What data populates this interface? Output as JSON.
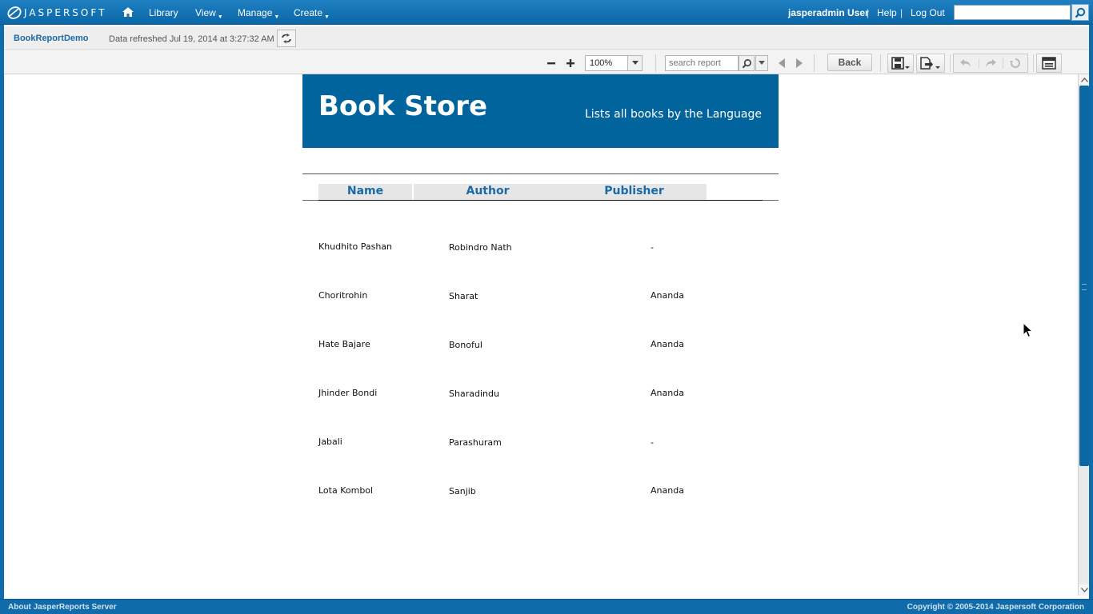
{
  "topbar": {
    "logo_text": "JASPERSOFT",
    "nav": {
      "library": "Library",
      "view": "View",
      "manage": "Manage",
      "create": "Create"
    },
    "user": "jasperadmin User",
    "help": "Help",
    "logout": "Log Out",
    "separator": "|",
    "search_value": ""
  },
  "titlebar": {
    "report_name": "BookReportDemo",
    "refresh_text": "Data refreshed Jul 19, 2014 at 3:27:32 AM"
  },
  "toolbar": {
    "zoom": "100%",
    "search_placeholder": "search report",
    "back_label": "Back"
  },
  "report": {
    "title": "Book Store",
    "subtitle": "Lists all books by the Language",
    "columns": {
      "name": "Name",
      "author": "Author",
      "publisher": "Publisher"
    },
    "rows": [
      {
        "name": "Khudhito Pashan",
        "author": "Robindro Nath",
        "publisher": "-"
      },
      {
        "name": "Choritrohin",
        "author": "Sharat",
        "publisher": "Ananda"
      },
      {
        "name": "Hate Bajare",
        "author": "Bonoful",
        "publisher": "Ananda"
      },
      {
        "name": "Jhinder Bondi",
        "author": "Sharadindu",
        "publisher": "Ananda"
      },
      {
        "name": "Jabali",
        "author": "Parashuram",
        "publisher": "-"
      },
      {
        "name": "Lota Kombol",
        "author": "Sanjib",
        "publisher": "Ananda"
      }
    ]
  },
  "footer": {
    "about": "About JasperReports Server",
    "copyright": "Copyright © 2005-2014 Jaspersoft Corporation"
  },
  "colors": {
    "brand_blue": "#0b68a8",
    "banner_blue": "#01649c",
    "link_blue": "#1a6aa8"
  }
}
